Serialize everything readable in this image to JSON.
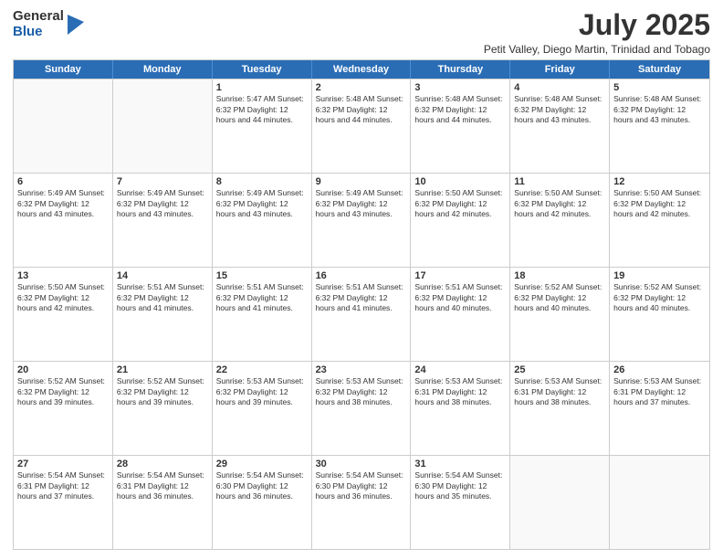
{
  "logo": {
    "general": "General",
    "blue": "Blue"
  },
  "title": {
    "month": "July 2025",
    "location": "Petit Valley, Diego Martin, Trinidad and Tobago"
  },
  "days_of_week": [
    "Sunday",
    "Monday",
    "Tuesday",
    "Wednesday",
    "Thursday",
    "Friday",
    "Saturday"
  ],
  "weeks": [
    [
      {
        "day": "",
        "info": ""
      },
      {
        "day": "",
        "info": ""
      },
      {
        "day": "1",
        "info": "Sunrise: 5:47 AM\nSunset: 6:32 PM\nDaylight: 12 hours and 44 minutes."
      },
      {
        "day": "2",
        "info": "Sunrise: 5:48 AM\nSunset: 6:32 PM\nDaylight: 12 hours and 44 minutes."
      },
      {
        "day": "3",
        "info": "Sunrise: 5:48 AM\nSunset: 6:32 PM\nDaylight: 12 hours and 44 minutes."
      },
      {
        "day": "4",
        "info": "Sunrise: 5:48 AM\nSunset: 6:32 PM\nDaylight: 12 hours and 43 minutes."
      },
      {
        "day": "5",
        "info": "Sunrise: 5:48 AM\nSunset: 6:32 PM\nDaylight: 12 hours and 43 minutes."
      }
    ],
    [
      {
        "day": "6",
        "info": "Sunrise: 5:49 AM\nSunset: 6:32 PM\nDaylight: 12 hours and 43 minutes."
      },
      {
        "day": "7",
        "info": "Sunrise: 5:49 AM\nSunset: 6:32 PM\nDaylight: 12 hours and 43 minutes."
      },
      {
        "day": "8",
        "info": "Sunrise: 5:49 AM\nSunset: 6:32 PM\nDaylight: 12 hours and 43 minutes."
      },
      {
        "day": "9",
        "info": "Sunrise: 5:49 AM\nSunset: 6:32 PM\nDaylight: 12 hours and 43 minutes."
      },
      {
        "day": "10",
        "info": "Sunrise: 5:50 AM\nSunset: 6:32 PM\nDaylight: 12 hours and 42 minutes."
      },
      {
        "day": "11",
        "info": "Sunrise: 5:50 AM\nSunset: 6:32 PM\nDaylight: 12 hours and 42 minutes."
      },
      {
        "day": "12",
        "info": "Sunrise: 5:50 AM\nSunset: 6:32 PM\nDaylight: 12 hours and 42 minutes."
      }
    ],
    [
      {
        "day": "13",
        "info": "Sunrise: 5:50 AM\nSunset: 6:32 PM\nDaylight: 12 hours and 42 minutes."
      },
      {
        "day": "14",
        "info": "Sunrise: 5:51 AM\nSunset: 6:32 PM\nDaylight: 12 hours and 41 minutes."
      },
      {
        "day": "15",
        "info": "Sunrise: 5:51 AM\nSunset: 6:32 PM\nDaylight: 12 hours and 41 minutes."
      },
      {
        "day": "16",
        "info": "Sunrise: 5:51 AM\nSunset: 6:32 PM\nDaylight: 12 hours and 41 minutes."
      },
      {
        "day": "17",
        "info": "Sunrise: 5:51 AM\nSunset: 6:32 PM\nDaylight: 12 hours and 40 minutes."
      },
      {
        "day": "18",
        "info": "Sunrise: 5:52 AM\nSunset: 6:32 PM\nDaylight: 12 hours and 40 minutes."
      },
      {
        "day": "19",
        "info": "Sunrise: 5:52 AM\nSunset: 6:32 PM\nDaylight: 12 hours and 40 minutes."
      }
    ],
    [
      {
        "day": "20",
        "info": "Sunrise: 5:52 AM\nSunset: 6:32 PM\nDaylight: 12 hours and 39 minutes."
      },
      {
        "day": "21",
        "info": "Sunrise: 5:52 AM\nSunset: 6:32 PM\nDaylight: 12 hours and 39 minutes."
      },
      {
        "day": "22",
        "info": "Sunrise: 5:53 AM\nSunset: 6:32 PM\nDaylight: 12 hours and 39 minutes."
      },
      {
        "day": "23",
        "info": "Sunrise: 5:53 AM\nSunset: 6:32 PM\nDaylight: 12 hours and 38 minutes."
      },
      {
        "day": "24",
        "info": "Sunrise: 5:53 AM\nSunset: 6:31 PM\nDaylight: 12 hours and 38 minutes."
      },
      {
        "day": "25",
        "info": "Sunrise: 5:53 AM\nSunset: 6:31 PM\nDaylight: 12 hours and 38 minutes."
      },
      {
        "day": "26",
        "info": "Sunrise: 5:53 AM\nSunset: 6:31 PM\nDaylight: 12 hours and 37 minutes."
      }
    ],
    [
      {
        "day": "27",
        "info": "Sunrise: 5:54 AM\nSunset: 6:31 PM\nDaylight: 12 hours and 37 minutes."
      },
      {
        "day": "28",
        "info": "Sunrise: 5:54 AM\nSunset: 6:31 PM\nDaylight: 12 hours and 36 minutes."
      },
      {
        "day": "29",
        "info": "Sunrise: 5:54 AM\nSunset: 6:30 PM\nDaylight: 12 hours and 36 minutes."
      },
      {
        "day": "30",
        "info": "Sunrise: 5:54 AM\nSunset: 6:30 PM\nDaylight: 12 hours and 36 minutes."
      },
      {
        "day": "31",
        "info": "Sunrise: 5:54 AM\nSunset: 6:30 PM\nDaylight: 12 hours and 35 minutes."
      },
      {
        "day": "",
        "info": ""
      },
      {
        "day": "",
        "info": ""
      }
    ]
  ]
}
